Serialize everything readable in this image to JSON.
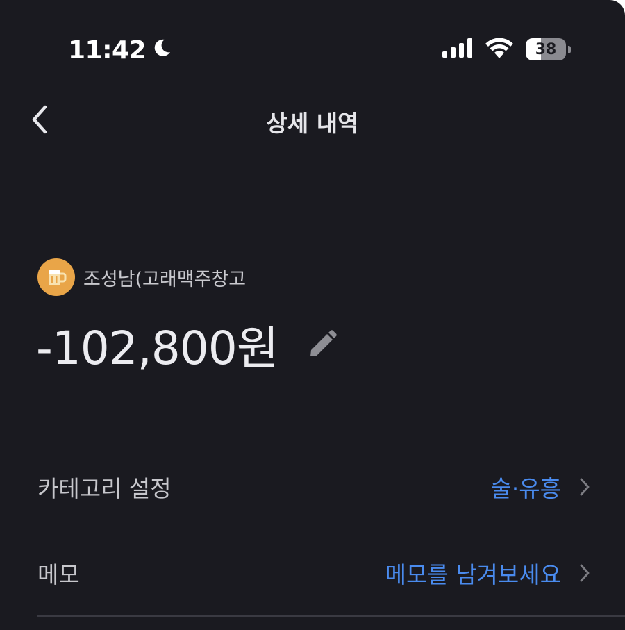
{
  "status_bar": {
    "time": "11:42",
    "battery_level": "38",
    "battery_fraction": 0.38
  },
  "nav": {
    "title": "상세 내역"
  },
  "merchant": {
    "name": "조성남(고래맥주창고",
    "avatar_icon": "beer-mug-icon",
    "avatar_color": "#e9a548"
  },
  "transaction": {
    "amount": "-102,800원"
  },
  "rows": {
    "category": {
      "label": "카테고리 설정",
      "value": "술·유흥"
    },
    "memo": {
      "label": "메모",
      "value": "메모를 남겨보세요"
    }
  },
  "colors": {
    "background": "#1a1a20",
    "accent": "#4a8bee"
  }
}
